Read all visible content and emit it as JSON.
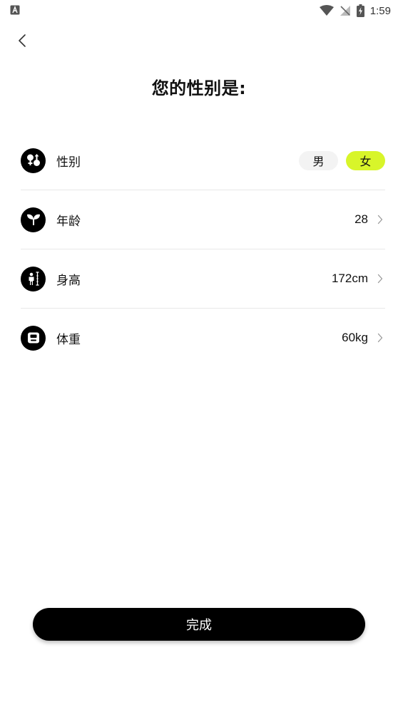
{
  "status_bar": {
    "time": "1:59",
    "icons": [
      "app-a-icon",
      "wifi-icon",
      "no-signal-icon",
      "battery-charging-icon"
    ]
  },
  "header": {
    "back_icon": "chevron-left-icon",
    "title": "您的性别是:"
  },
  "rows": [
    {
      "key": "gender",
      "icon": "gender-icon",
      "label": "性别",
      "options": [
        "男",
        "女"
      ],
      "selected": "女"
    },
    {
      "key": "age",
      "icon": "sprout-icon",
      "label": "年龄",
      "value": "28"
    },
    {
      "key": "height",
      "icon": "height-measure-icon",
      "label": "身高",
      "value": "172cm"
    },
    {
      "key": "weight",
      "icon": "scale-icon",
      "label": "体重",
      "value": "60kg"
    }
  ],
  "footer": {
    "done_label": "完成"
  },
  "colors": {
    "accent": "#d8f52a",
    "primary": "#000000",
    "divider": "#e8e8e8",
    "option_bg": "#f3f3f3"
  }
}
